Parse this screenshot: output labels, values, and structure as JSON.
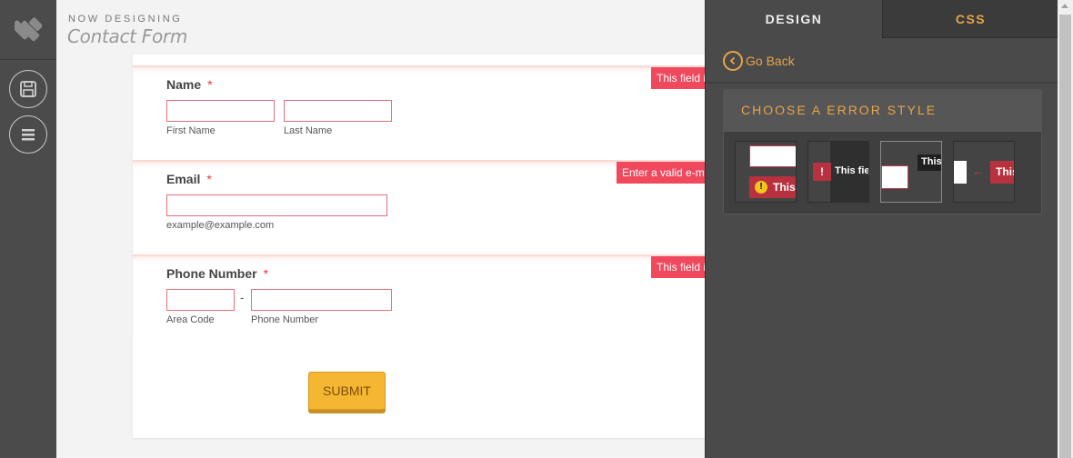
{
  "header": {
    "subtitle": "NOW DESIGNING",
    "title": "Contact Form"
  },
  "form": {
    "name": {
      "label": "Name",
      "required": "*",
      "first_sub": "First Name",
      "last_sub": "Last Name",
      "error": "This field i"
    },
    "email": {
      "label": "Email",
      "required": "*",
      "sub": "example@example.com",
      "error": "Enter a valid e-m"
    },
    "phone": {
      "label": "Phone Number",
      "required": "*",
      "dash": "-",
      "area_sub": "Area Code",
      "number_sub": "Phone Number",
      "error": "This field i"
    },
    "submit_label": "SUBMIT"
  },
  "panel": {
    "tabs": [
      {
        "label": "DESIGN",
        "active": true
      },
      {
        "label": "CSS",
        "active": false
      }
    ],
    "go_back": "Go Back",
    "error_style": {
      "title": "CHOOSE A ERROR STYLE",
      "options": [
        {
          "sample": "This",
          "icon": "!"
        },
        {
          "sample": "This fie",
          "icon": "!"
        },
        {
          "sample": "This",
          "selected": true
        },
        {
          "sample": "This",
          "icon": "←"
        }
      ]
    }
  },
  "colors": {
    "accent": "#e7a448",
    "error": "#f0495e",
    "submit": "#f5b731",
    "panel": "#4a4a4a"
  }
}
